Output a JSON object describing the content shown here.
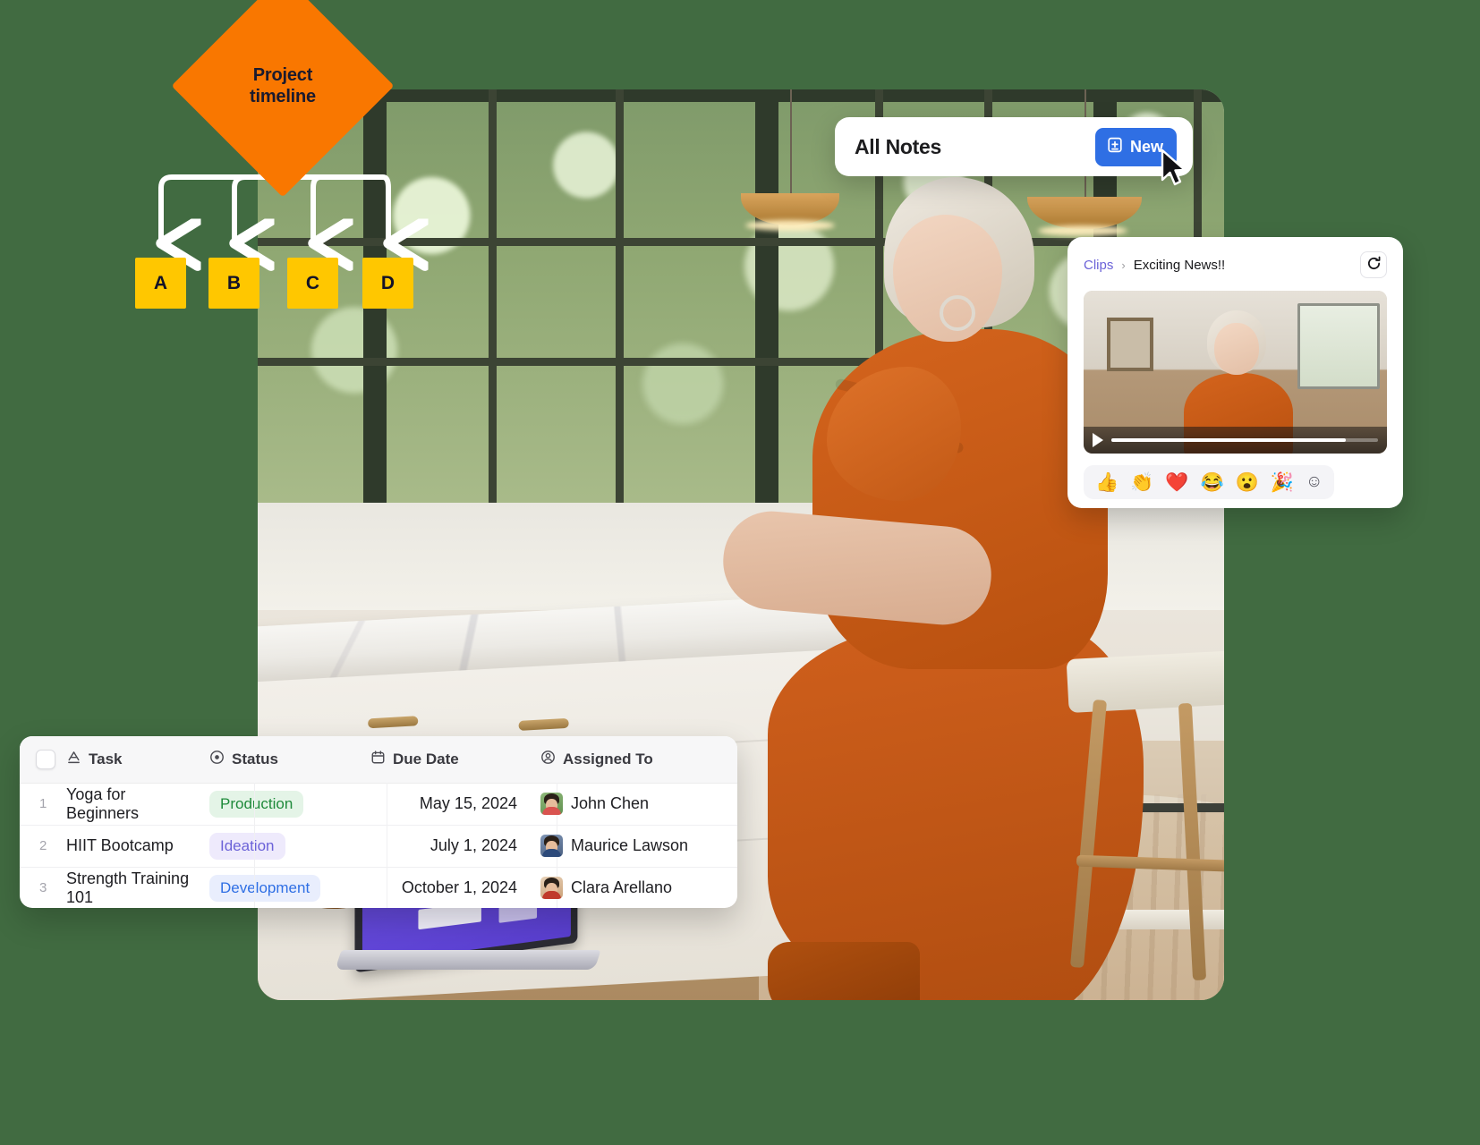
{
  "flowchart": {
    "root_label_line1": "Project",
    "root_label_line2": "timeline",
    "nodes": [
      {
        "label": "A"
      },
      {
        "label": "B"
      },
      {
        "label": "C"
      },
      {
        "label": "D"
      }
    ],
    "root_color": "#F97700",
    "node_color": "#FFC700",
    "connector_color": "#FFFFFF"
  },
  "notes_card": {
    "title": "All Notes",
    "new_button_label": "New",
    "new_button_color": "#2F6FE4",
    "new_icon": "new-note-plus-icon",
    "cursor_icon": "mouse-pointer-icon"
  },
  "clips_card": {
    "breadcrumb_root": "Clips",
    "breadcrumb_separator": "›",
    "breadcrumb_current": "Exciting News!!",
    "breadcrumb_root_color": "#6B62D8",
    "refresh_icon": "refresh-icon",
    "video": {
      "play_icon": "play-icon",
      "progress_percent": 88
    },
    "reactions": [
      {
        "name": "thumbs-up-emoji",
        "glyph": "👍"
      },
      {
        "name": "clap-emoji",
        "glyph": "👏"
      },
      {
        "name": "heart-emoji",
        "glyph": "❤️"
      },
      {
        "name": "joy-emoji",
        "glyph": "😂"
      },
      {
        "name": "astonished-emoji",
        "glyph": "😮"
      },
      {
        "name": "party-popper-emoji",
        "glyph": "🎉"
      }
    ],
    "add_reaction_icon": "add-reaction-icon",
    "add_reaction_glyph": "☺"
  },
  "task_table": {
    "columns": [
      {
        "key": "select",
        "label": "",
        "icon": "checkbox-icon"
      },
      {
        "key": "task",
        "label": "Task",
        "icon": "text-format-icon"
      },
      {
        "key": "status",
        "label": "Status",
        "icon": "status-circle-icon"
      },
      {
        "key": "due_date",
        "label": "Due Date",
        "icon": "calendar-icon"
      },
      {
        "key": "assigned_to",
        "label": "Assigned To",
        "icon": "person-circle-icon"
      }
    ],
    "rows": [
      {
        "num": "1",
        "task": "Yoga for Beginners",
        "status": "Production",
        "status_style": "green",
        "due_date": "May 15, 2024",
        "assignee": "John Chen",
        "avatar_style": "av1"
      },
      {
        "num": "2",
        "task": "HIIT Bootcamp",
        "status": "Ideation",
        "status_style": "violet",
        "due_date": "July 1, 2024",
        "assignee": "Maurice Lawson",
        "avatar_style": "av2"
      },
      {
        "num": "3",
        "task": "Strength Training 101",
        "status": "Development",
        "status_style": "blue",
        "due_date": "October 1, 2024",
        "assignee": "Clara Arellano",
        "avatar_style": "av3"
      }
    ],
    "status_colors": {
      "green": "#1F8A3B",
      "violet": "#6B62D8",
      "blue": "#2F6FE4"
    }
  },
  "photo": {
    "alt": "woman-working-on-laptop-in-kitchen"
  }
}
